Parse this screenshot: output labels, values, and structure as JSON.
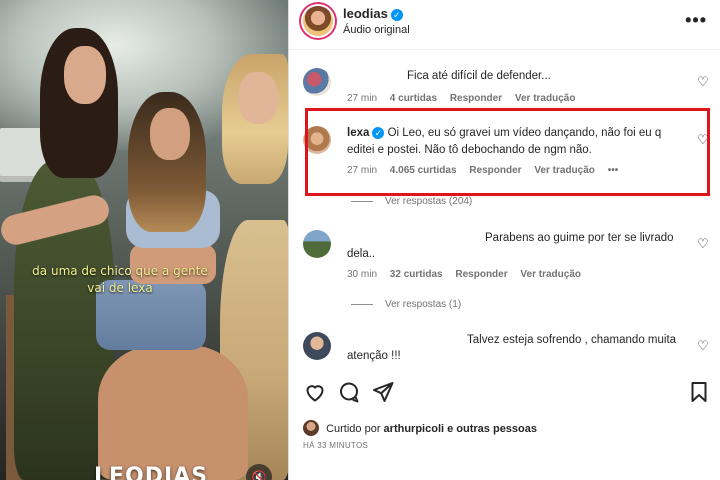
{
  "video": {
    "caption_line1": "da uma de chico que a gente",
    "caption_line2": "vai de lexa",
    "watermark": "LEODIAS"
  },
  "post_header": {
    "username": "leodias",
    "verified": true,
    "audio_label": "Áudio original"
  },
  "comments": [
    {
      "username": "",
      "text": "Fica até difícil de defender...",
      "time": "27 min",
      "likes": "4 curtidas",
      "reply": "Responder",
      "translate": "Ver tradução"
    },
    {
      "username": "lexa",
      "verified": true,
      "text": "Oi Leo, eu só gravei um vídeo dançando, não foi eu q editei e postei. Não tô debochando de ngm não.",
      "time": "27 min",
      "likes": "4.065 curtidas",
      "reply": "Responder",
      "translate": "Ver tradução",
      "more": "•••",
      "view_replies": "Ver respostas (204)"
    },
    {
      "username": "",
      "text_line1": "Parabens ao guime por ter se livrado",
      "text_line2": "dela..",
      "time": "30 min",
      "likes": "32 curtidas",
      "reply": "Responder",
      "translate": "Ver tradução",
      "view_replies": "Ver respostas (1)"
    },
    {
      "username": "",
      "text_line1": "Talvez esteja sofrendo , chamando muita",
      "text_line2": "atenção !!!"
    }
  ],
  "actions": {
    "icons": [
      "heart-icon",
      "comment-icon",
      "share-icon",
      "bookmark-icon"
    ]
  },
  "liked_by": {
    "prefix": "Curtido por",
    "user": "arthurpicoli",
    "suffix": "e outras pessoas"
  },
  "timestamp": "HÁ 33 MINUTOS",
  "colors": {
    "highlight_border": "#e0151b",
    "verified": "#0095f6",
    "caption": "#f4ef8f"
  }
}
